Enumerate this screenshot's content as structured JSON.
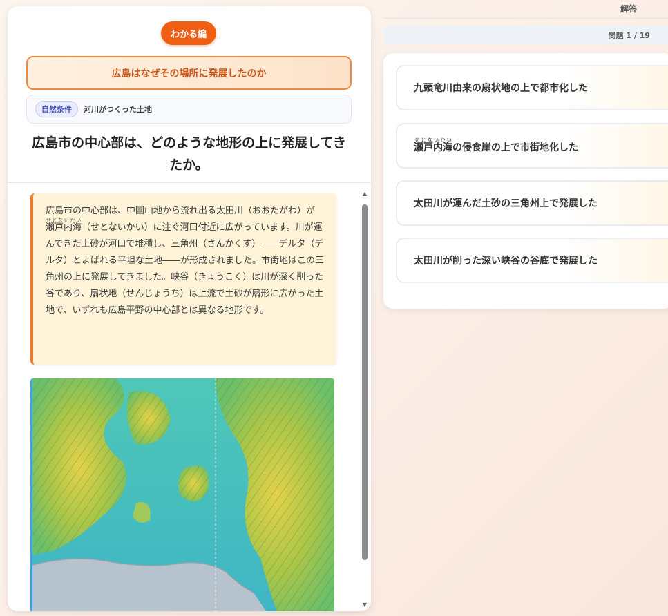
{
  "header": {
    "badge": "わかる編",
    "topic": "広島はなぜその場所に発展したのか",
    "tag_chip": "自然条件",
    "tag_text": "河川がつくった土地",
    "question": "広島市の中心部は、どのような地形の上に発展してきたか。"
  },
  "explanation": {
    "part1": "広島市の中心部は、中国山地から流れ出る太田川（おおたがわ）が",
    "ruby_base": "瀬戸内海",
    "ruby_text": "せとないかい",
    "part2": "（せとないかい）に注ぐ河口付近に広がっています。川が運んできた土砂が河口で堆積し、三角州（さんかくす）――デルタ（デルタ）とよばれる平坦な土地――が形成されました。市街地はこの三角州の上に発展してきました。峡谷（きょうこく）は川が深く削った谷であり、扇状地（せんじょうち）は上流で土砂が扇形に広がった土地で、いずれも広島平野の中心部とは異なる地形です。"
  },
  "right": {
    "answer_label": "解答",
    "progress": "問題 1 / 19",
    "choices": [
      {
        "label": "九頭竜川由来の扇状地の上で都市化した"
      },
      {
        "ruby_base": "瀬戸内海",
        "ruby_text": "せとないかい",
        "rest": "の侵食崖の上で市街地化した"
      },
      {
        "label": "太田川が運んだ土砂の三角州上で発展した"
      },
      {
        "label": "太田川が削った深い峡谷の谷底で発展した"
      }
    ]
  },
  "colors": {
    "accent": "#ee5f14",
    "topic_border": "#f08a3c",
    "explain_bg": "#fff4d8",
    "map_border": "#3ea3e6"
  },
  "icons": {
    "scroll_up": "triangle-up-icon",
    "scroll_down": "triangle-down-icon"
  }
}
